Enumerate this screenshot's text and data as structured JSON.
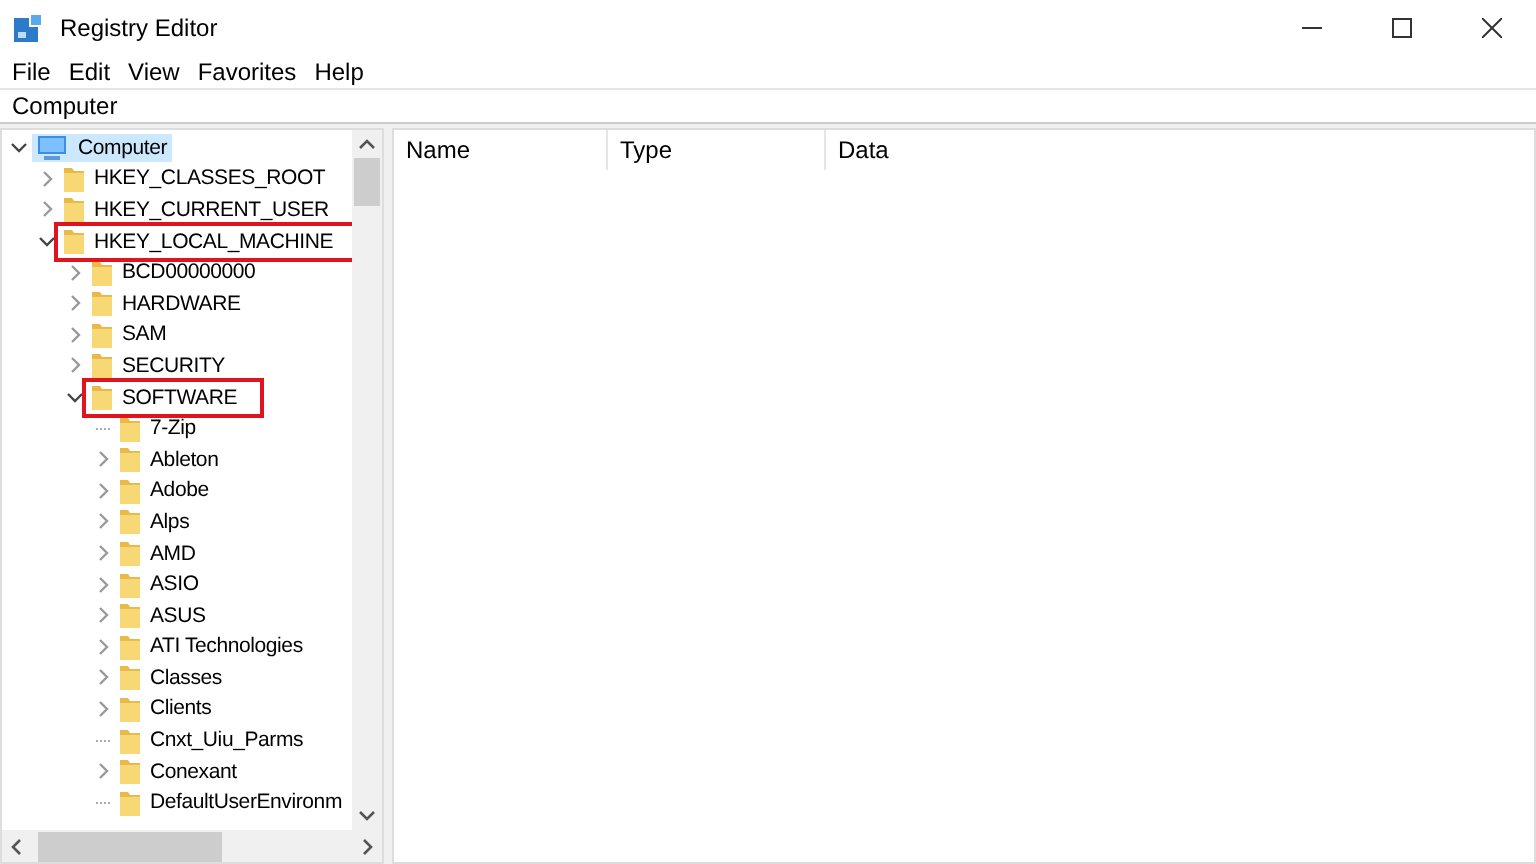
{
  "window": {
    "title": "Registry Editor"
  },
  "menu": [
    "File",
    "Edit",
    "View",
    "Favorites",
    "Help"
  ],
  "address": {
    "value": "Computer"
  },
  "tree": [
    {
      "label": "Computer",
      "kind": "computer",
      "expandable": true,
      "expanded": true,
      "selected": true,
      "highlighted": false,
      "children": [
        {
          "label": "HKEY_CLASSES_ROOT",
          "expandable": true,
          "expanded": false,
          "selected": false,
          "highlighted": false
        },
        {
          "label": "HKEY_CURRENT_USER",
          "expandable": true,
          "expanded": false,
          "selected": false,
          "highlighted": false
        },
        {
          "label": "HKEY_LOCAL_MACHINE",
          "expandable": true,
          "expanded": true,
          "selected": false,
          "highlighted": true,
          "children": [
            {
              "label": "BCD00000000",
              "expandable": true,
              "expanded": false,
              "selected": false,
              "highlighted": false
            },
            {
              "label": "HARDWARE",
              "expandable": true,
              "expanded": false,
              "selected": false,
              "highlighted": false
            },
            {
              "label": "SAM",
              "expandable": true,
              "expanded": false,
              "selected": false,
              "highlighted": false
            },
            {
              "label": "SECURITY",
              "expandable": true,
              "expanded": false,
              "selected": false,
              "highlighted": false
            },
            {
              "label": "SOFTWARE",
              "expandable": true,
              "expanded": true,
              "selected": false,
              "highlighted": true,
              "children": [
                {
                  "label": "7-Zip",
                  "expandable": false,
                  "selected": false,
                  "highlighted": false
                },
                {
                  "label": "Ableton",
                  "expandable": true,
                  "expanded": false,
                  "selected": false,
                  "highlighted": false
                },
                {
                  "label": "Adobe",
                  "expandable": true,
                  "expanded": false,
                  "selected": false,
                  "highlighted": false
                },
                {
                  "label": "Alps",
                  "expandable": true,
                  "expanded": false,
                  "selected": false,
                  "highlighted": false
                },
                {
                  "label": "AMD",
                  "expandable": true,
                  "expanded": false,
                  "selected": false,
                  "highlighted": false
                },
                {
                  "label": "ASIO",
                  "expandable": true,
                  "expanded": false,
                  "selected": false,
                  "highlighted": false
                },
                {
                  "label": "ASUS",
                  "expandable": true,
                  "expanded": false,
                  "selected": false,
                  "highlighted": false
                },
                {
                  "label": "ATI Technologies",
                  "expandable": true,
                  "expanded": false,
                  "selected": false,
                  "highlighted": false
                },
                {
                  "label": "Classes",
                  "expandable": true,
                  "expanded": false,
                  "selected": false,
                  "highlighted": false
                },
                {
                  "label": "Clients",
                  "expandable": true,
                  "expanded": false,
                  "selected": false,
                  "highlighted": false
                },
                {
                  "label": "Cnxt_Uiu_Parms",
                  "expandable": false,
                  "selected": false,
                  "highlighted": false
                },
                {
                  "label": "Conexant",
                  "expandable": true,
                  "expanded": false,
                  "selected": false,
                  "highlighted": false
                },
                {
                  "label": "DefaultUserEnvironm",
                  "expandable": false,
                  "selected": false,
                  "highlighted": false
                }
              ]
            }
          ]
        }
      ]
    }
  ],
  "columns": [
    "Name",
    "Type",
    "Data"
  ]
}
